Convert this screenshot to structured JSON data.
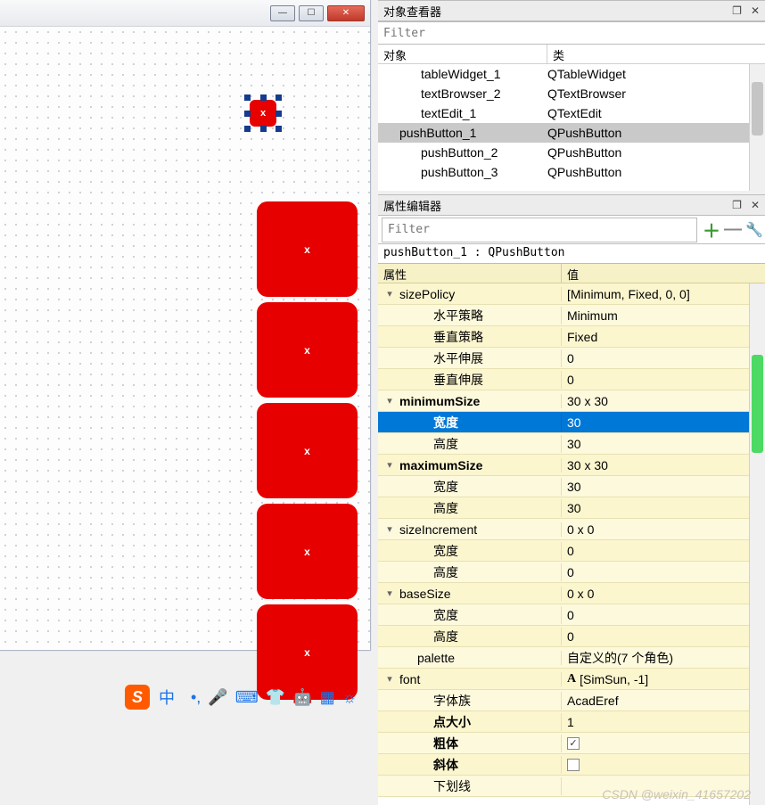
{
  "design": {
    "button_label": "x",
    "big_buttons": [
      "x",
      "x",
      "x",
      "x",
      "x"
    ]
  },
  "object_inspector": {
    "title": "对象查看器",
    "filter_placeholder": "Filter",
    "col_object": "对象",
    "col_class": "类",
    "items": [
      {
        "name": "tableWidget_1",
        "cls": "QTableWidget",
        "indent": true
      },
      {
        "name": "textBrowser_2",
        "cls": "QTextBrowser",
        "indent": true
      },
      {
        "name": "textEdit_1",
        "cls": "QTextEdit",
        "indent": true
      },
      {
        "name": "pushButton_1",
        "cls": "QPushButton",
        "selected": true
      },
      {
        "name": "pushButton_2",
        "cls": "QPushButton",
        "indent": true
      },
      {
        "name": "pushButton_3",
        "cls": "QPushButton",
        "indent": true
      }
    ]
  },
  "property_editor": {
    "title": "属性编辑器",
    "filter_placeholder": "Filter",
    "object_label": "pushButton_1 : QPushButton",
    "col_property": "属性",
    "col_value": "值",
    "rows": [
      {
        "expand": "v",
        "label": "sizePolicy",
        "value": "[Minimum, Fixed, 0, 0]"
      },
      {
        "indent": 2,
        "label": "水平策略",
        "value": "Minimum"
      },
      {
        "indent": 2,
        "label": "垂直策略",
        "value": "Fixed"
      },
      {
        "indent": 2,
        "label": "水平伸展",
        "value": "0"
      },
      {
        "indent": 2,
        "label": "垂直伸展",
        "value": "0"
      },
      {
        "expand": "v",
        "bold": true,
        "label": "minimumSize",
        "value": "30 x 30"
      },
      {
        "indent": 2,
        "bold": true,
        "label": "宽度",
        "value": "30",
        "selected": true
      },
      {
        "indent": 2,
        "label": "高度",
        "value": "30"
      },
      {
        "expand": "v",
        "bold": true,
        "label": "maximumSize",
        "value": "30 x 30"
      },
      {
        "indent": 2,
        "label": "宽度",
        "value": "30"
      },
      {
        "indent": 2,
        "label": "高度",
        "value": "30"
      },
      {
        "expand": "v",
        "label": "sizeIncrement",
        "value": "0 x 0"
      },
      {
        "indent": 2,
        "label": "宽度",
        "value": "0"
      },
      {
        "indent": 2,
        "label": "高度",
        "value": "0"
      },
      {
        "expand": "v",
        "label": "baseSize",
        "value": "0 x 0"
      },
      {
        "indent": 2,
        "label": "宽度",
        "value": "0"
      },
      {
        "indent": 2,
        "label": "高度",
        "value": "0"
      },
      {
        "indent": 1,
        "label": "palette",
        "value": "自定义的(7 个角色)"
      },
      {
        "expand": "v",
        "label": "font",
        "value": "[SimSun, -1]",
        "font_icon": "A"
      },
      {
        "indent": 2,
        "label": "字体族",
        "value": "AcadEref"
      },
      {
        "indent": 2,
        "bold": true,
        "label": "点大小",
        "value": "1"
      },
      {
        "indent": 2,
        "bold": true,
        "label": "粗体",
        "checkbox": true,
        "checked": true
      },
      {
        "indent": 2,
        "bold": true,
        "label": "斜体",
        "checkbox": true,
        "checked": false
      },
      {
        "indent": 2,
        "label": "下划线",
        "value": ""
      }
    ]
  },
  "ime": {
    "logo": "S",
    "lang": "中",
    "icons": [
      "•,",
      "🎤",
      "⌨",
      "👕",
      "🤖",
      "▦",
      "☼"
    ]
  },
  "watermark": "CSDN @weixin_41657202"
}
